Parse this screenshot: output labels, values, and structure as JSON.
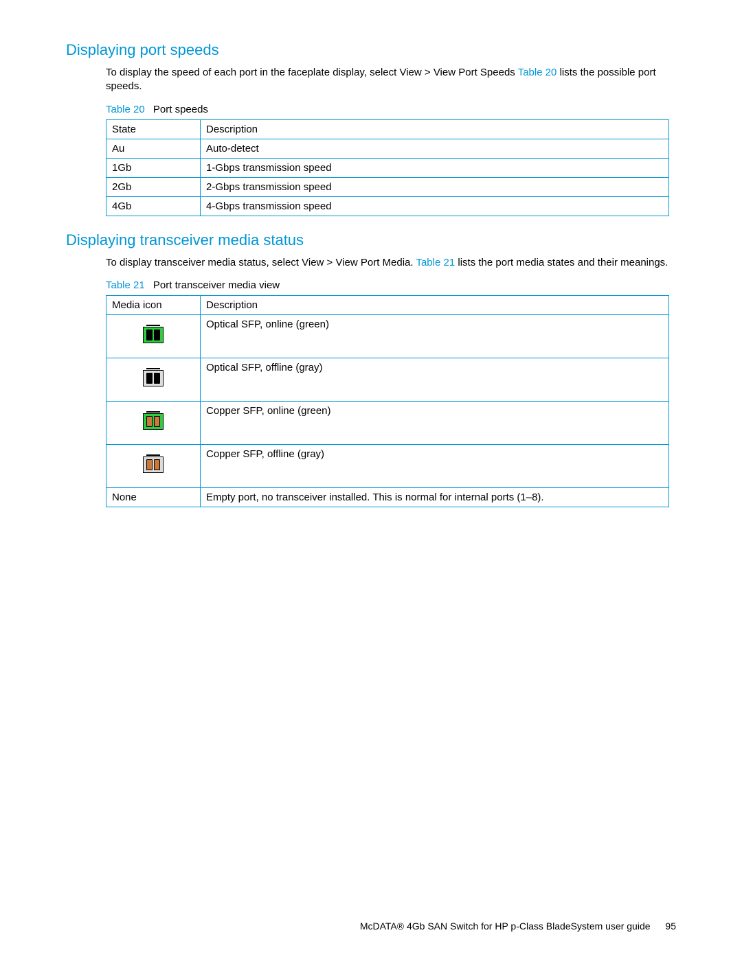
{
  "section1": {
    "title": "Displaying port speeds",
    "intro_before_link": "To display the speed of each port in the faceplate display, select View > View Port Speeds ",
    "intro_link": "Table 20",
    "intro_after_link": " lists the possible port speeds.",
    "caption_link": "Table 20",
    "caption_text": "Port speeds",
    "table": {
      "headers": [
        "State",
        "Description"
      ],
      "rows": [
        [
          "Au",
          "Auto-detect"
        ],
        [
          "1Gb",
          "1-Gbps transmission speed"
        ],
        [
          "2Gb",
          "2-Gbps transmission speed"
        ],
        [
          "4Gb",
          "4-Gbps transmission speed"
        ]
      ]
    }
  },
  "section2": {
    "title": "Displaying transceiver media status",
    "intro_before_link": "To display transceiver media status, select View > View Port Media. ",
    "intro_link": "Table 21",
    "intro_after_link": " lists the port media states and their meanings.",
    "caption_link": "Table 21",
    "caption_text": "Port transceiver media view",
    "table": {
      "headers": [
        "Media icon",
        "Description"
      ],
      "rows": [
        {
          "icon": "optical-green",
          "desc": "Optical SFP, online (green)"
        },
        {
          "icon": "optical-gray",
          "desc": "Optical SFP, offline (gray)"
        },
        {
          "icon": "copper-green",
          "desc": "Copper SFP, online (green)"
        },
        {
          "icon": "copper-gray",
          "desc": "Copper SFP, offline (gray)"
        },
        {
          "icon": "none",
          "icon_label": "None",
          "desc": "Empty port, no transceiver installed. This is normal for internal ports (1–8)."
        }
      ]
    }
  },
  "footer": {
    "text": "McDATA® 4Gb SAN Switch for HP p-Class BladeSystem user guide",
    "page": "95"
  }
}
